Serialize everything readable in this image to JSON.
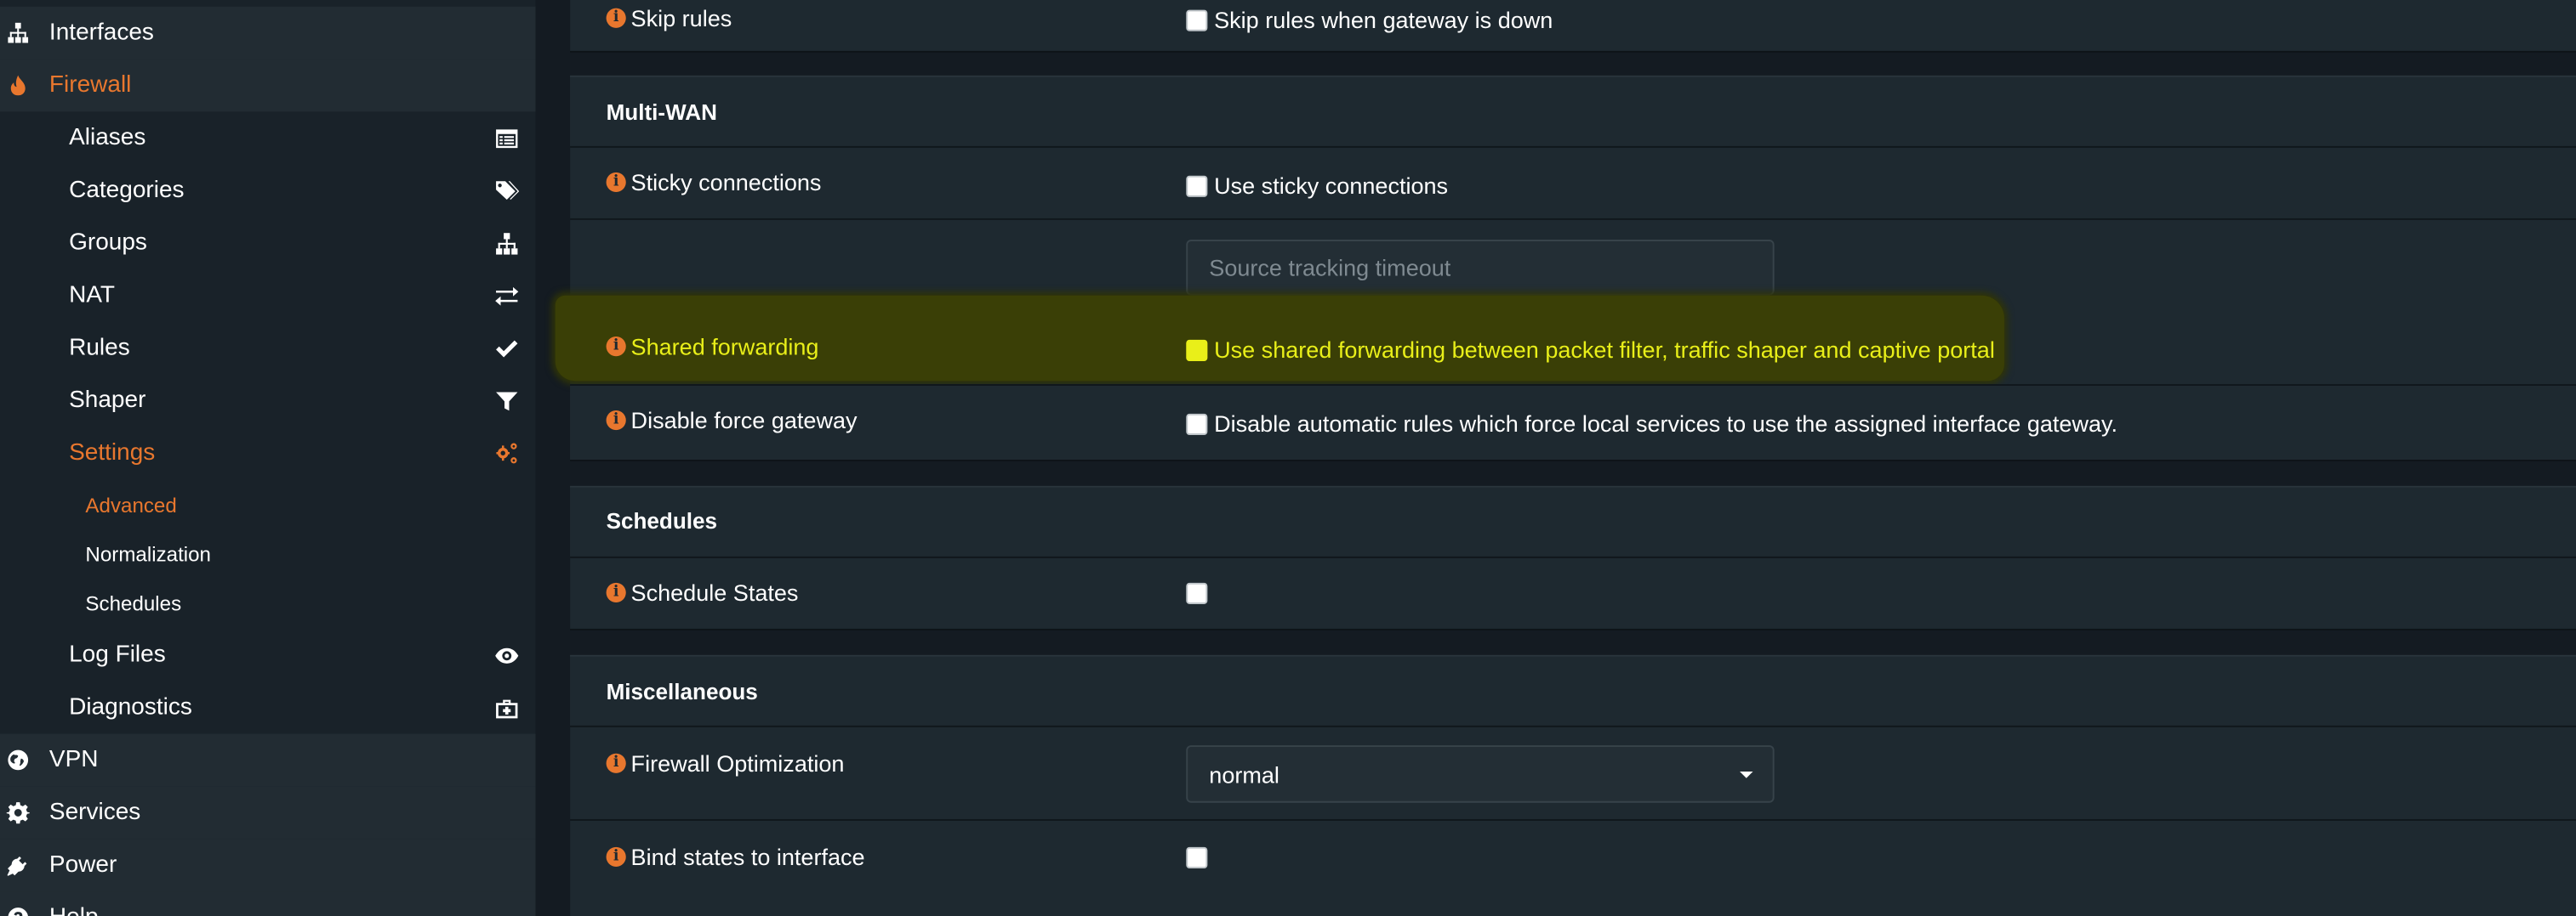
{
  "sidebar": {
    "top_items": [
      {
        "label": "Interfaces",
        "icon": "sitemap-icon"
      },
      {
        "label": "Firewall",
        "icon": "fire-icon",
        "active": true
      },
      {
        "label": "VPN",
        "icon": "globe-icon"
      },
      {
        "label": "Services",
        "icon": "gear-icon"
      },
      {
        "label": "Power",
        "icon": "plug-icon"
      },
      {
        "label": "Help",
        "icon": "help-icon"
      }
    ],
    "firewall_items": [
      {
        "label": "Aliases",
        "icon": "list-icon"
      },
      {
        "label": "Categories",
        "icon": "tags-icon"
      },
      {
        "label": "Groups",
        "icon": "sitemap-icon"
      },
      {
        "label": "NAT",
        "icon": "exchange-icon"
      },
      {
        "label": "Rules",
        "icon": "check-icon"
      },
      {
        "label": "Shaper",
        "icon": "filter-icon"
      },
      {
        "label": "Settings",
        "icon": "cogs-icon",
        "active": true
      },
      {
        "label": "Log Files",
        "icon": "eye-icon"
      },
      {
        "label": "Diagnostics",
        "icon": "medkit-icon"
      }
    ],
    "settings_items": [
      {
        "label": "Advanced",
        "active": true
      },
      {
        "label": "Normalization"
      },
      {
        "label": "Schedules"
      }
    ]
  },
  "main": {
    "skip_rules": {
      "label": "Skip rules",
      "checkbox_label": "Skip rules when gateway is down"
    },
    "multiwan": {
      "title": "Multi-WAN",
      "sticky": {
        "label": "Sticky connections",
        "checkbox_label": "Use sticky connections"
      },
      "source_tracking": {
        "placeholder": "Source tracking timeout"
      },
      "shared_forwarding": {
        "label": "Shared forwarding",
        "checkbox_label": "Use shared forwarding between packet filter, traffic shaper and captive portal"
      },
      "disable_force_gateway": {
        "label": "Disable force gateway",
        "checkbox_label": "Disable automatic rules which force local services to use the assigned interface gateway."
      }
    },
    "schedules": {
      "title": "Schedules",
      "schedule_states": {
        "label": "Schedule States"
      }
    },
    "misc": {
      "title": "Miscellaneous",
      "firewall_optimization": {
        "label": "Firewall Optimization",
        "value": "normal"
      },
      "bind_states": {
        "label": "Bind states to interface"
      }
    }
  },
  "colors": {
    "accent": "#e8772e",
    "highlight_text": "#e9ef19",
    "highlight_bg": "#3a3f06",
    "sidebar_bg": "#192229",
    "panel_bg": "#1e2930"
  }
}
